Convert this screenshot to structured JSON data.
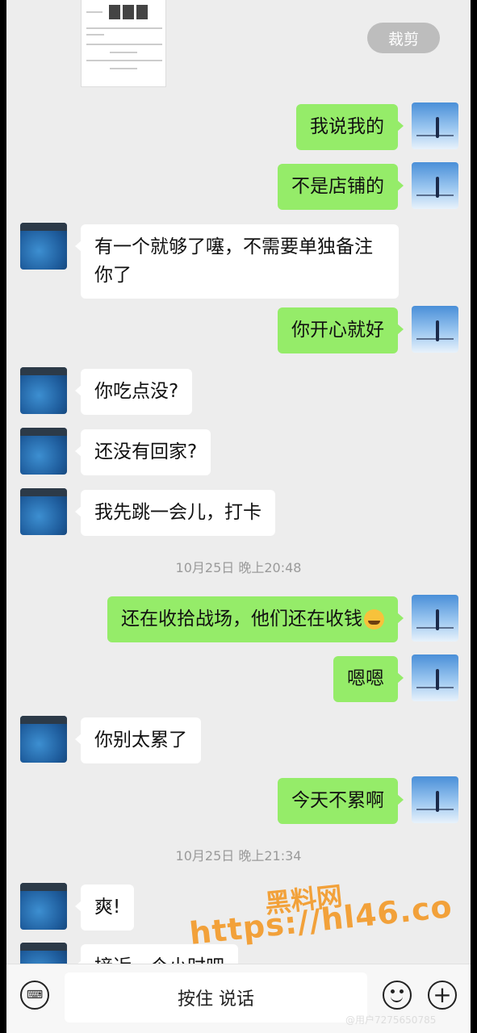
{
  "toolbar": {
    "crop_label": "裁剪"
  },
  "messages": [
    {
      "side": "me",
      "text": "我说我的"
    },
    {
      "side": "me",
      "text": "不是店铺的"
    },
    {
      "side": "other",
      "text": "有一个就够了噻，不需要单独备注你了"
    },
    {
      "side": "me",
      "text": "你开心就好"
    },
    {
      "side": "other",
      "text": "你吃点没?"
    },
    {
      "side": "other",
      "text": "还没有回家?"
    },
    {
      "side": "other",
      "text": "我先跳一会儿，打卡"
    },
    {
      "side": "me",
      "text": "还在收拾战场，他们还在收钱",
      "emoji": "laugh-cry-emoji"
    },
    {
      "side": "me",
      "text": "嗯嗯"
    },
    {
      "side": "other",
      "text": "你别太累了"
    },
    {
      "side": "me",
      "text": "今天不累啊"
    },
    {
      "side": "other",
      "text": "爽!"
    },
    {
      "side": "other",
      "text": "接近一个小时吧"
    }
  ],
  "timestamps": [
    "10月25日 晚上20:48",
    "10月25日 晚上21:34"
  ],
  "input": {
    "hold_to_talk": "按住 说话",
    "keyboard_glyph": "⌨",
    "plus_glyph": "+"
  },
  "watermark": {
    "line1": "黑料网",
    "line2": "https://hl46.co",
    "credit": "@用户7275650785"
  },
  "colors": {
    "my_bubble": "#95ec69",
    "other_bubble": "#ffffff",
    "background": "#ededed"
  }
}
